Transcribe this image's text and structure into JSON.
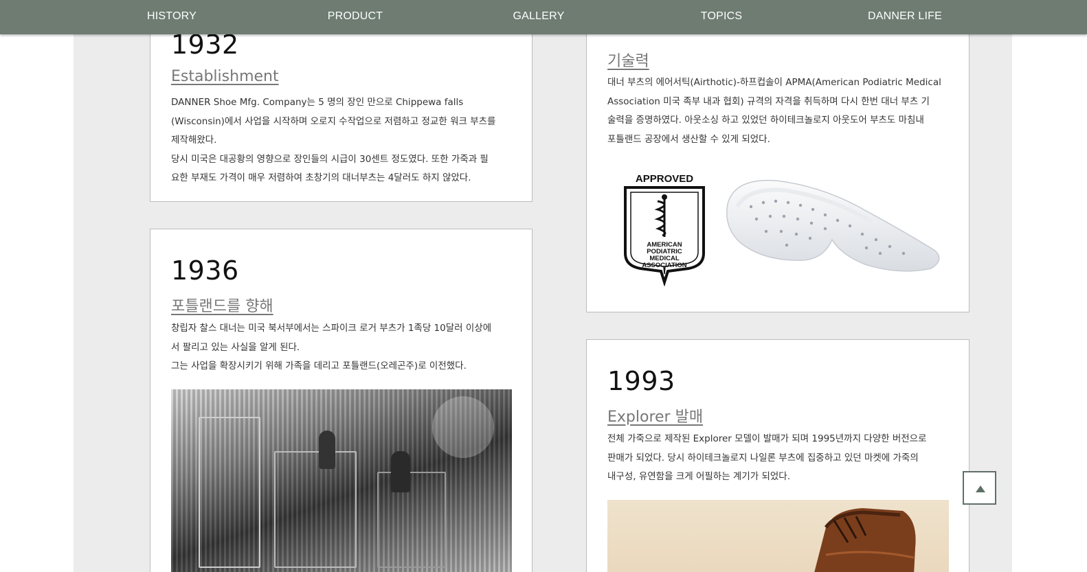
{
  "nav": {
    "items": [
      {
        "label": "HISTORY"
      },
      {
        "label": "PRODUCT"
      },
      {
        "label": "GALLERY"
      },
      {
        "label": "TOPICS"
      },
      {
        "label": "DANNER LIFE"
      }
    ]
  },
  "cards": {
    "y1932": {
      "year": "1932",
      "title": "Establishment",
      "lines": [
        "DANNER Shoe Mfg. Company는 5 명의 장인 만으로 Chippewa falls",
        "(Wisconsin)에서 사업을 시작하며 오로지 수작업으로 저렴하고 정교한 워크 부츠를",
        "제작해왔다.",
        "당시 미국은 대공황의 영향으로 장인들의 시급이 30센트 정도였다. 또한 가죽과 필",
        "요한 부재도 가격이 매우 저렴하여 초창기의 대너부츠는 4달러도 하지 않았다."
      ]
    },
    "y1936": {
      "year": "1936",
      "title": "포틀랜드를 향해",
      "lines": [
        "창립자 찰스 대너는 미국 북서부에서는 스파이크 로거 부츠가 1족당 10달러 이상에",
        "서 팔리고 있는 사실을 알게 된다.",
        "그는 사업을 확장시키기 위해 가족을 데리고 포틀랜드(오레곤주)로 이전했다."
      ]
    },
    "tech": {
      "title": "기술력",
      "lines": [
        "대너 부츠의 에어서틱(Airthotic)-하프컵솔이 APMA(American Podiatric Medical",
        "Association 미국 족부 내과 협회) 규격의 자격을 취득하며 다시 한번 대너 부츠 기",
        "술력을 증명하였다. 아웃소싱 하고 있었던 하이테크놀로지 아웃도어 부츠도 마침내",
        "포틀랜드 공장에서 생산할 수 있게 되었다."
      ],
      "badge": {
        "top": "APPROVED",
        "line1": "AMERICAN",
        "line2": "PODIATRIC",
        "line3": "MEDICAL",
        "line4": "ASSOCIATION"
      }
    },
    "y1993": {
      "year": "1993",
      "title": "Explorer 발매",
      "lines": [
        "전체 가죽으로 제작된 Explorer 모델이 발매가 되며 1995년까지 다양한 버전으로",
        "판매가 되었다. 당시 하이테크놀로지 나일론 부츠에 집중하고 있던 마켓에 가죽의",
        "내구성, 유연함을 크게 어필하는 계기가 되었다."
      ]
    }
  },
  "colors": {
    "nav_bg": "#6e7c72",
    "page_bg": "#ececec",
    "title_gray": "#777777",
    "accent": "#5f6f66"
  },
  "icons": {
    "scroll_top": "triangle-up-icon"
  }
}
